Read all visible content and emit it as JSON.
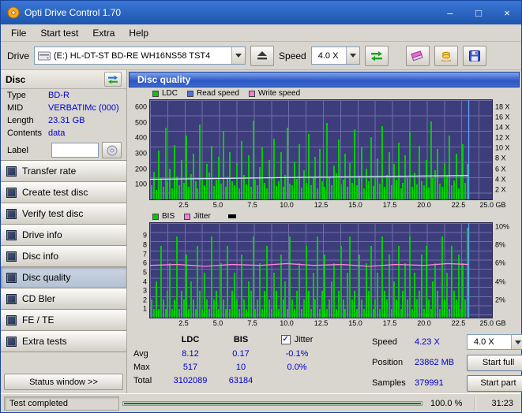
{
  "window": {
    "title": "Opti Drive Control 1.70"
  },
  "icons": {
    "minimize": "–",
    "maximize": "□",
    "close": "×",
    "check": "✓"
  },
  "menu": {
    "items": [
      "File",
      "Start test",
      "Extra",
      "Help"
    ]
  },
  "toolbar": {
    "drive_label": "Drive",
    "drive_value": "(E:)  HL-DT-ST BD-RE  WH16NS58 TST4",
    "speed_label": "Speed",
    "speed_value": "4.0 X"
  },
  "sidebar": {
    "header": "Disc",
    "info": [
      {
        "label": "Type",
        "value": "BD-R"
      },
      {
        "label": "MID",
        "value": "VERBATIMc (000)"
      },
      {
        "label": "Length",
        "value": "23.31 GB"
      },
      {
        "label": "Contents",
        "value": "data"
      }
    ],
    "label_label": "Label",
    "label_value": "",
    "buttons": [
      "Transfer rate",
      "Create test disc",
      "Verify test disc",
      "Drive info",
      "Disc info",
      "Disc quality",
      "CD Bler",
      "FE / TE",
      "Extra tests"
    ],
    "active_button": "Disc quality",
    "status_window_label": "Status window >>"
  },
  "panel": {
    "title": "Disc quality"
  },
  "chart_data": [
    {
      "type": "bar",
      "series": "LDC",
      "bar_color": "#00cc00",
      "legend": [
        {
          "label": "LDC",
          "color": "#00cc00"
        },
        {
          "label": "Read speed",
          "color": "#4f6fe0"
        },
        {
          "label": "Write speed",
          "color": "#f07fd8"
        }
      ],
      "ymax": 650,
      "left_ticks": [
        {
          "v": 600,
          "label": "600"
        },
        {
          "v": 500,
          "label": "500"
        },
        {
          "v": 400,
          "label": "400"
        },
        {
          "v": 300,
          "label": "300"
        },
        {
          "v": 200,
          "label": "200"
        },
        {
          "v": 100,
          "label": "100"
        }
      ],
      "right_max": 19.5,
      "right_ticks": [
        {
          "v": 18,
          "label": "18 X"
        },
        {
          "v": 16,
          "label": "16 X"
        },
        {
          "v": 14,
          "label": "14 X"
        },
        {
          "v": 12,
          "label": "12 X"
        },
        {
          "v": 10,
          "label": "10 X"
        },
        {
          "v": 8,
          "label": "8 X"
        },
        {
          "v": 6,
          "label": "6 X"
        },
        {
          "v": 4,
          "label": "4 X"
        },
        {
          "v": 2,
          "label": "2 X"
        }
      ],
      "x_max": 25,
      "x_ticks": [
        {
          "v": 2.5,
          "label": "2.5"
        },
        {
          "v": 5,
          "label": "5.0"
        },
        {
          "v": 7.5,
          "label": "7.5"
        },
        {
          "v": 10,
          "label": "10.0"
        },
        {
          "v": 12.5,
          "label": "12.5"
        },
        {
          "v": 15,
          "label": "15.0"
        },
        {
          "v": 17.5,
          "label": "17.5"
        },
        {
          "v": 20,
          "label": "20.0"
        },
        {
          "v": 22.5,
          "label": "22.5"
        },
        {
          "v": 25,
          "label": "25.0 GB"
        }
      ],
      "values": [
        95,
        180,
        60,
        320,
        140,
        85,
        470,
        120,
        200,
        75,
        355,
        150,
        95,
        260,
        110,
        420,
        85,
        165,
        300,
        120,
        70,
        490,
        140,
        95,
        230,
        175,
        350,
        90,
        130,
        280,
        105,
        450,
        85,
        150,
        310,
        120,
        95,
        240,
        70,
        380,
        160,
        100,
        290,
        85,
        517,
        130,
        95,
        210,
        340,
        110,
        75,
        260,
        145,
        400,
        90,
        120,
        310,
        85,
        160,
        470,
        105,
        95,
        250,
        135,
        360,
        80,
        190,
        110,
        430,
        95,
        145,
        280,
        70,
        330,
        120,
        85,
        500,
        150,
        95,
        220,
        170,
        390,
        100,
        130,
        300,
        85,
        240,
        110,
        460,
        95,
        155,
        340,
        75,
        200,
        120,
        410,
        90,
        140,
        270,
        105,
        480,
        85,
        160,
        310,
        95,
        230,
        130,
        370,
        70,
        110,
        290,
        145,
        440,
        85,
        175,
        100,
        350,
        120,
        95,
        260,
        80,
        510,
        140,
        190,
        330,
        105,
        85,
        240,
        155,
        420,
        95,
        125,
        300,
        75,
        160,
        360,
        110,
        230
      ],
      "line": {
        "name": "read-speed",
        "color": "#d9e6ff",
        "scale_max": 19.5,
        "points": [
          [
            0,
            3.95
          ],
          [
            20,
            4.1
          ],
          [
            40,
            4.3
          ],
          [
            60,
            4.45
          ],
          [
            80,
            4.6
          ],
          [
            93.2,
            4.68
          ]
        ]
      },
      "end_marker": {
        "x": 93.2,
        "color": "#5fa0ff"
      }
    },
    {
      "type": "bar",
      "series": "BIS",
      "bar_color": "#00cc00",
      "legend": [
        {
          "label": "BIS",
          "color": "#00cc00"
        },
        {
          "label": "Jitter",
          "color": "#f07fd8"
        }
      ],
      "ymax": 10.5,
      "left_ticks": [
        {
          "v": 9,
          "label": "9"
        },
        {
          "v": 8,
          "label": "8"
        },
        {
          "v": 7,
          "label": "7"
        },
        {
          "v": 6,
          "label": "6"
        },
        {
          "v": 5,
          "label": "5"
        },
        {
          "v": 4,
          "label": "4"
        },
        {
          "v": 3,
          "label": "3"
        },
        {
          "v": 2,
          "label": "2"
        },
        {
          "v": 1,
          "label": "1"
        }
      ],
      "right_max": 10.5,
      "right_ticks": [
        {
          "v": 10,
          "label": "10%"
        },
        {
          "v": 8,
          "label": "8%"
        },
        {
          "v": 6,
          "label": "6%"
        },
        {
          "v": 4,
          "label": "4%"
        },
        {
          "v": 2,
          "label": "2%"
        }
      ],
      "x_max": 25,
      "x_ticks": [
        {
          "v": 2.5,
          "label": "2.5"
        },
        {
          "v": 5,
          "label": "5.0"
        },
        {
          "v": 7.5,
          "label": "7.5"
        },
        {
          "v": 10,
          "label": "10.0"
        },
        {
          "v": 12.5,
          "label": "12.5"
        },
        {
          "v": 15,
          "label": "15.0"
        },
        {
          "v": 17.5,
          "label": "17.5"
        },
        {
          "v": 20,
          "label": "20.0"
        },
        {
          "v": 22.5,
          "label": "22.5"
        },
        {
          "v": 25,
          "label": "25.0 GB"
        }
      ],
      "values": [
        2,
        1,
        4,
        1,
        8,
        2,
        1,
        3,
        6,
        1,
        2,
        9,
        1,
        3,
        2,
        7,
        1,
        4,
        2,
        1,
        8,
        3,
        1,
        5,
        2,
        1,
        9,
        2,
        3,
        1,
        6,
        2,
        1,
        8,
        1,
        3,
        5,
        2,
        1,
        7,
        2,
        1,
        4,
        3,
        9,
        1,
        2,
        6,
        1,
        3,
        8,
        2,
        1,
        5,
        3,
        1,
        7,
        2,
        4,
        1,
        9,
        2,
        1,
        3,
        6,
        1,
        2,
        8,
        3,
        1,
        5,
        2,
        9,
        1,
        3,
        7,
        1,
        2,
        4,
        6,
        1,
        3,
        8,
        2,
        1,
        5,
        9,
        2,
        3,
        1,
        7,
        2,
        1,
        6,
        3,
        8,
        1,
        2,
        5,
        1,
        9,
        3,
        2,
        7,
        1,
        4,
        2,
        8,
        1,
        3,
        6,
        2,
        9,
        1,
        5,
        2,
        3,
        7,
        1,
        8,
        2,
        1,
        4,
        6,
        3,
        1,
        9,
        2,
        5,
        1,
        8,
        3,
        2,
        7,
        1,
        6,
        2,
        10
      ],
      "line": {
        "name": "jitter",
        "color": "#ff85d8",
        "scale_max": 10.5,
        "points": [
          [
            0,
            5.8
          ],
          [
            8,
            5.9
          ],
          [
            16,
            5.7
          ],
          [
            24,
            5.9
          ],
          [
            32,
            5.8
          ],
          [
            40,
            6.0
          ],
          [
            48,
            5.8
          ],
          [
            56,
            5.9
          ],
          [
            64,
            5.7
          ],
          [
            72,
            5.9
          ],
          [
            80,
            5.8
          ],
          [
            87,
            6.0
          ],
          [
            93.2,
            5.9
          ]
        ]
      },
      "end_marker": {
        "x": 93.2,
        "color": "#5fa0ff"
      }
    }
  ],
  "stats": {
    "columns": [
      "LDC",
      "BIS"
    ],
    "jitter_label": "Jitter",
    "jitter_checked": true,
    "rows": [
      {
        "label": "Avg",
        "ldc": "8.12",
        "bis": "0.17",
        "jitter": "-0.1%"
      },
      {
        "label": "Max",
        "ldc": "517",
        "bis": "10",
        "jitter": "0.0%"
      },
      {
        "label": "Total",
        "ldc": "3102089",
        "bis": "63184",
        "jitter": ""
      }
    ],
    "speed_label": "Speed",
    "speed_value": "4.23 X",
    "speed_combo": "4.0 X",
    "position_label": "Position",
    "position_value": "23862 MB",
    "samples_label": "Samples",
    "samples_value": "379991",
    "start_full_label": "Start full",
    "start_part_label": "Start part"
  },
  "statusbar": {
    "status": "Test completed",
    "percent": "100.0 %",
    "time": "31:23",
    "progress_percent": 100
  }
}
